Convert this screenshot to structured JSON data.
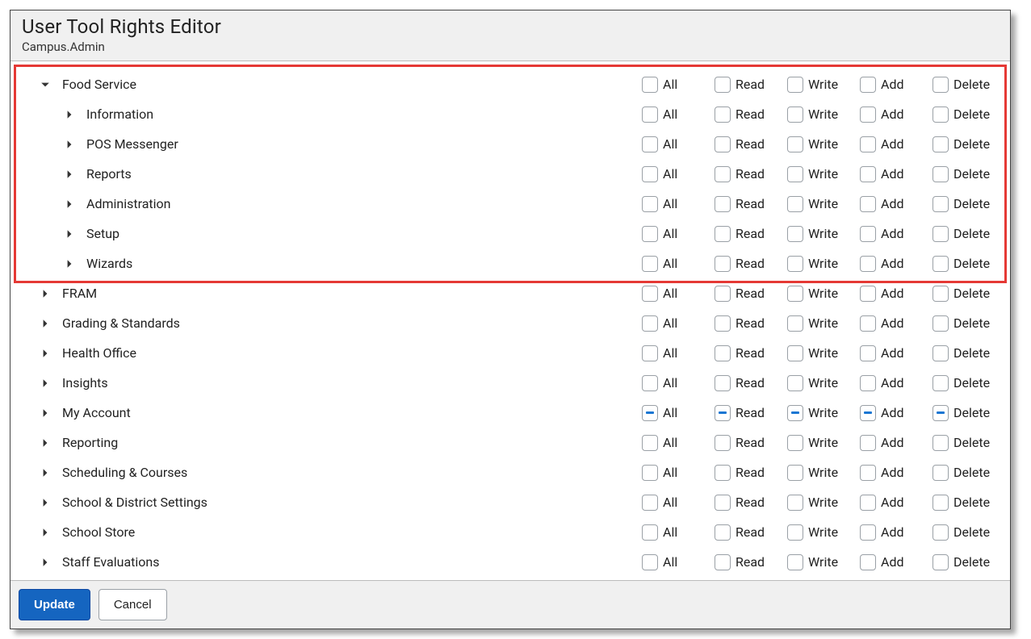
{
  "header": {
    "title": "User Tool Rights Editor",
    "subtitle": "Campus.Admin"
  },
  "columns": {
    "all": "All",
    "read": "Read",
    "write": "Write",
    "add": "Add",
    "delete": "Delete"
  },
  "rows": [
    {
      "label": "Food Service",
      "indent": 0,
      "expanded": true,
      "highlighted": true,
      "indeterminate": false
    },
    {
      "label": "Information",
      "indent": 1,
      "expanded": false,
      "highlighted": true,
      "indeterminate": false
    },
    {
      "label": "POS Messenger",
      "indent": 1,
      "expanded": false,
      "highlighted": true,
      "indeterminate": false
    },
    {
      "label": "Reports",
      "indent": 1,
      "expanded": false,
      "highlighted": true,
      "indeterminate": false
    },
    {
      "label": "Administration",
      "indent": 1,
      "expanded": false,
      "highlighted": true,
      "indeterminate": false
    },
    {
      "label": "Setup",
      "indent": 1,
      "expanded": false,
      "highlighted": true,
      "indeterminate": false
    },
    {
      "label": "Wizards",
      "indent": 1,
      "expanded": false,
      "highlighted": true,
      "indeterminate": false
    },
    {
      "label": "FRAM",
      "indent": 0,
      "expanded": false,
      "highlighted": false,
      "indeterminate": false
    },
    {
      "label": "Grading & Standards",
      "indent": 0,
      "expanded": false,
      "highlighted": false,
      "indeterminate": false
    },
    {
      "label": "Health Office",
      "indent": 0,
      "expanded": false,
      "highlighted": false,
      "indeterminate": false
    },
    {
      "label": "Insights",
      "indent": 0,
      "expanded": false,
      "highlighted": false,
      "indeterminate": false
    },
    {
      "label": "My Account",
      "indent": 0,
      "expanded": false,
      "highlighted": false,
      "indeterminate": true
    },
    {
      "label": "Reporting",
      "indent": 0,
      "expanded": false,
      "highlighted": false,
      "indeterminate": false
    },
    {
      "label": "Scheduling & Courses",
      "indent": 0,
      "expanded": false,
      "highlighted": false,
      "indeterminate": false
    },
    {
      "label": "School & District Settings",
      "indent": 0,
      "expanded": false,
      "highlighted": false,
      "indeterminate": false
    },
    {
      "label": "School Store",
      "indent": 0,
      "expanded": false,
      "highlighted": false,
      "indeterminate": false
    },
    {
      "label": "Staff Evaluations",
      "indent": 0,
      "expanded": false,
      "highlighted": false,
      "indeterminate": false
    }
  ],
  "footer": {
    "update": "Update",
    "cancel": "Cancel"
  }
}
